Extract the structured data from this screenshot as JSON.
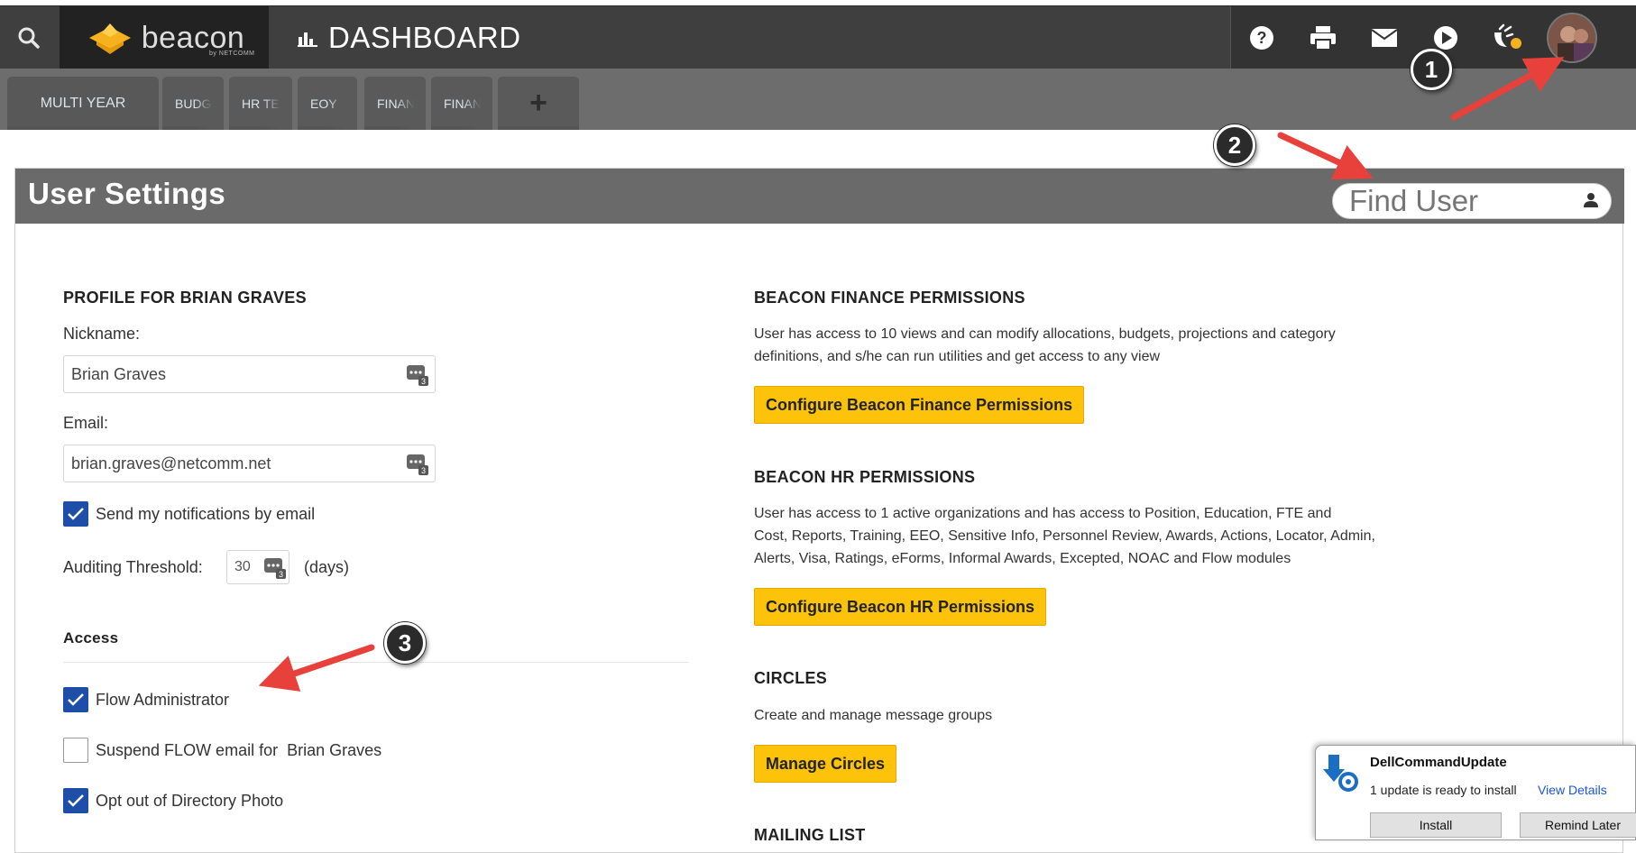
{
  "header": {
    "logo_text": "beacon",
    "logo_sub": "by NETCOMM",
    "dashboard_label": "DASHBOARD",
    "icons": [
      "search-icon",
      "help-icon",
      "print-icon",
      "mail-icon",
      "play-icon",
      "notification-icon",
      "avatar"
    ]
  },
  "tabs": [
    {
      "label": "MULTI YEAR"
    },
    {
      "label": "BUDG"
    },
    {
      "label": "HR TE"
    },
    {
      "label": "EOY"
    },
    {
      "label": "FINAN"
    },
    {
      "label": "FINAN"
    },
    {
      "label": "+"
    }
  ],
  "panel": {
    "title": "User Settings",
    "find_user_placeholder": "Find User"
  },
  "profile": {
    "heading": "PROFILE FOR BRIAN GRAVES",
    "nickname_label": "Nickname:",
    "nickname_value": "Brian Graves",
    "email_label": "Email:",
    "email_value": "brian.graves@netcomm.net",
    "notify_label": "Send my notifications by email",
    "notify_checked": true,
    "auditing_label": "Auditing Threshold:",
    "auditing_value": "30",
    "auditing_unit": "(days)"
  },
  "access": {
    "heading": "Access",
    "items": [
      {
        "label": "Flow Administrator",
        "checked": true
      },
      {
        "label": "Suspend FLOW email for  Brian Graves",
        "checked": false
      },
      {
        "label": "Opt out of Directory Photo",
        "checked": true
      }
    ]
  },
  "finance": {
    "heading": "BEACON FINANCE PERMISSIONS",
    "text_line1": "User has access to 10 views and can modify allocations, budgets, projections and category",
    "text_line2": "definitions, and s/he can run utilities and get access to any view",
    "button": "Configure Beacon Finance Permissions"
  },
  "hr": {
    "heading": "BEACON HR PERMISSIONS",
    "text_line1": "User has access to 1 active organizations and has access to Position, Education, FTE and",
    "text_line2": "Cost, Reports, Training, EEO, Sensitive Info, Personnel Review, Awards, Actions, Locator, Admin,",
    "text_line3": "Alerts, Visa, Ratings, eForms, Informal Awards, Excepted, NOAC and Flow modules",
    "button": "Configure Beacon HR Permissions"
  },
  "circles": {
    "heading": "CIRCLES",
    "text": "Create and manage message groups",
    "button": "Manage Circles"
  },
  "mailing": {
    "heading": "MAILING LIST"
  },
  "annotations": {
    "m1": "1",
    "m2": "2",
    "m3": "3",
    "arrow_color": "#e8403a"
  },
  "toast": {
    "title": "DellCommandUpdate",
    "message": "1 update is ready to install",
    "link": "View Details",
    "install": "Install",
    "remind": "Remind Later"
  },
  "colors": {
    "accent_button": "#fcc30a",
    "checkbox": "#1f4ea8",
    "header": "#3f3f3f"
  }
}
